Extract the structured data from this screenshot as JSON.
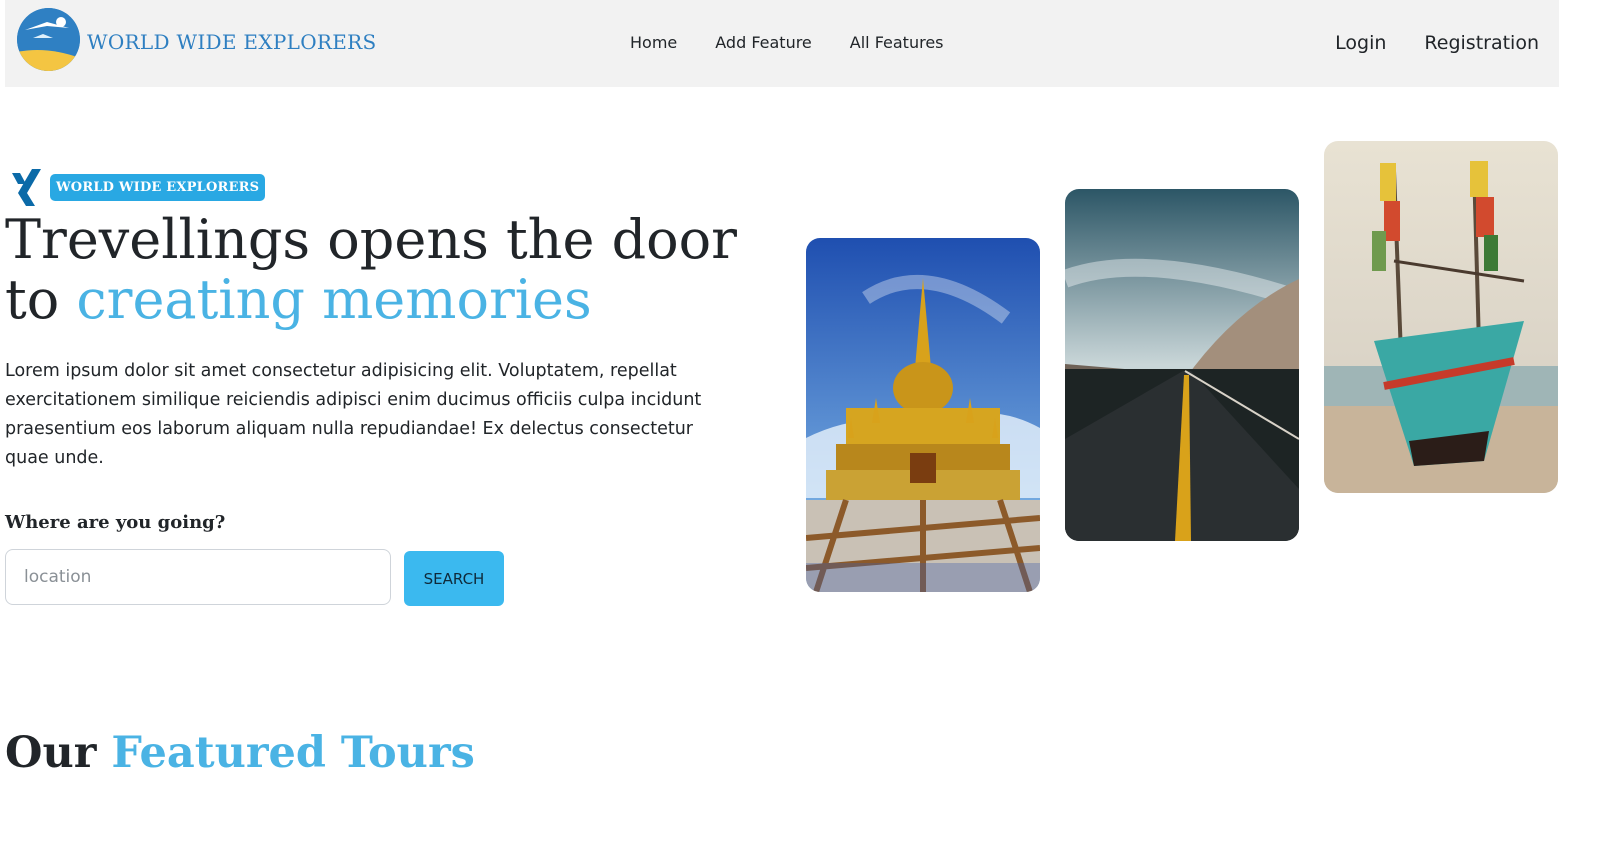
{
  "navbar": {
    "brand": "WORLD WIDE EXPLORERS",
    "logo_icon": "globe-plane-logo",
    "links": [
      "Home",
      "Add Feature",
      "All Features"
    ],
    "auth": [
      "Login",
      "Registration"
    ]
  },
  "hero": {
    "badge_icon": "xing-icon",
    "badge_text": "WORLD WIDE EXPLORERS",
    "title_line1": "Trevellings opens the door",
    "title_prefix": "to",
    "title_accent": "creating memories",
    "paragraph": "Lorem ipsum dolor sit amet consectetur adipisicing elit. Voluptatem, repellat exercitationem similique reiciendis adipisci enim ducimus officiis culpa incidunt praesentium eos laborum aliquam nulla repudiandae! Ex delectus consectetur quae unde.",
    "search_label": "Where are you going?",
    "search_placeholder": "location",
    "search_button": "SEARCH"
  },
  "gallery": [
    {
      "subject": "golden pagoda temple"
    },
    {
      "subject": "mountain road"
    },
    {
      "subject": "fishing boat on beach"
    }
  ],
  "featured": {
    "title_prefix": "Our",
    "title_accent": "Featured Tours"
  },
  "colors": {
    "accent": "#4ab3e4",
    "button": "#3bb9ef",
    "badge": "#29a8e3",
    "navbar_bg": "#f2f2f2"
  }
}
